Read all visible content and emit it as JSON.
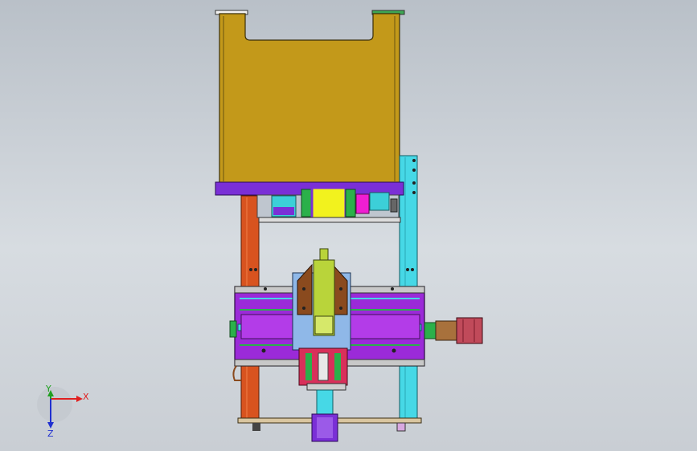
{
  "triad": {
    "x_label": "X",
    "y_label": "Y",
    "z_label": "Z",
    "x_color": "#e02020",
    "y_color": "#20a020",
    "z_color": "#2030d0"
  },
  "colors": {
    "hopper": "#c3991a",
    "base_plate": "#7a2fd6",
    "column_left": "#d8531f",
    "column_right": "#46d8e6",
    "slide_frame": "#9b2ad8",
    "carriage": "#8fb8e8",
    "cylinder": "#b9d43a",
    "bracket": "#8a4a1e",
    "motor": "#c04a5a",
    "yellow_block": "#f2f21e",
    "pink_block": "#f01ed2"
  },
  "icons": [
    "axis-triad-icon"
  ]
}
